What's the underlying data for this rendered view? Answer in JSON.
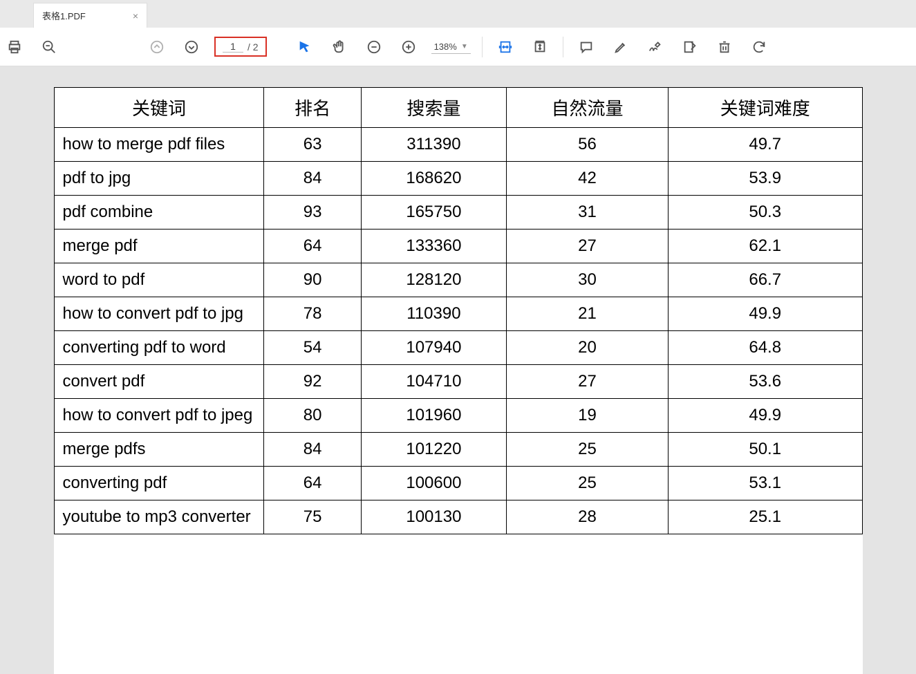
{
  "tab": {
    "title": "表格1.PDF"
  },
  "pager": {
    "current": "1",
    "total": "/ 2"
  },
  "zoom": {
    "value": "138%"
  },
  "table": {
    "headers": [
      "关键词",
      "排名",
      "搜索量",
      "自然流量",
      "关键词难度"
    ],
    "rows": [
      {
        "kw": "how to merge pdf files",
        "rank": "63",
        "vol": "311390",
        "traffic": "56",
        "diff": "49.7"
      },
      {
        "kw": "pdf to jpg",
        "rank": "84",
        "vol": "168620",
        "traffic": "42",
        "diff": "53.9"
      },
      {
        "kw": "pdf combine",
        "rank": "93",
        "vol": "165750",
        "traffic": "31",
        "diff": "50.3"
      },
      {
        "kw": "merge pdf",
        "rank": "64",
        "vol": "133360",
        "traffic": "27",
        "diff": "62.1"
      },
      {
        "kw": "word to pdf",
        "rank": "90",
        "vol": "128120",
        "traffic": "30",
        "diff": "66.7"
      },
      {
        "kw": "how to convert pdf to jpg",
        "rank": "78",
        "vol": "110390",
        "traffic": "21",
        "diff": "49.9"
      },
      {
        "kw": "converting pdf to word",
        "rank": "54",
        "vol": "107940",
        "traffic": "20",
        "diff": "64.8"
      },
      {
        "kw": "convert pdf",
        "rank": "92",
        "vol": "104710",
        "traffic": "27",
        "diff": "53.6"
      },
      {
        "kw": "how to convert pdf to jpeg",
        "rank": "80",
        "vol": "101960",
        "traffic": "19",
        "diff": "49.9"
      },
      {
        "kw": "merge pdfs",
        "rank": "84",
        "vol": "101220",
        "traffic": "25",
        "diff": "50.1"
      },
      {
        "kw": "converting pdf",
        "rank": "64",
        "vol": "100600",
        "traffic": "25",
        "diff": "53.1"
      },
      {
        "kw": "youtube to mp3 converter",
        "rank": "75",
        "vol": "100130",
        "traffic": "28",
        "diff": "25.1"
      }
    ]
  }
}
